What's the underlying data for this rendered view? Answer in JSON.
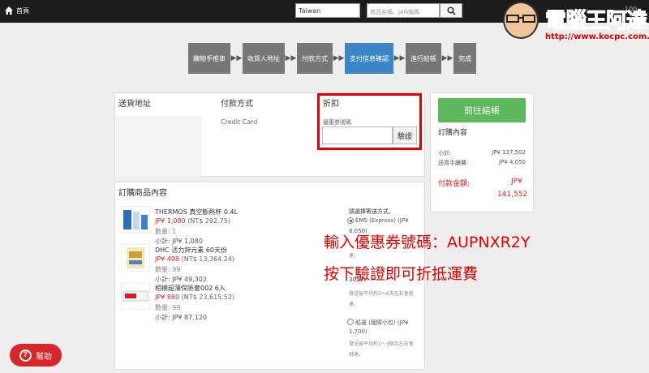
{
  "header": {
    "home_label": "首頁",
    "country_value": "Taiwan",
    "search_placeholder": "商品名稱、JAN編碼",
    "cart_count": "100"
  },
  "watermark": {
    "title": "電腦王阿達",
    "url": "http://www.kocpc.com.tw"
  },
  "steps": [
    {
      "label": "購物手推車"
    },
    {
      "label": "收貨人地址"
    },
    {
      "label": "付款方式"
    },
    {
      "label": "支付信息確認"
    },
    {
      "label": "進行結帳"
    },
    {
      "label": "完成"
    }
  ],
  "address": {
    "title": "送貨地址"
  },
  "payment": {
    "title": "付款方式",
    "value": "Credit Card"
  },
  "discount": {
    "title": "折扣",
    "coupon_label": "優惠券號碼",
    "verify_label": "驗證"
  },
  "order": {
    "title": "訂購商品內容",
    "items": [
      {
        "name": "THERMOS 真空斷熱杯 0.4L",
        "price_jp": "JP¥ 1,080",
        "price_nt": "(NT$ 292.75)",
        "qty": "數量: 1",
        "subtotal": "小計: JP¥ 1,080"
      },
      {
        "name": "DHC 活力鋅元素 60天份",
        "price_jp": "JP¥ 498",
        "price_nt": "(NT$ 13,364.24)",
        "qty": "數量: 99",
        "subtotal": "小計: JP¥ 49,302"
      },
      {
        "name": "相模超薄保險套002 6入",
        "price_jp": "JP¥ 880",
        "price_nt": "(NT$ 23,615.52)",
        "qty": "數量: 99",
        "subtotal": "小計: JP¥ 87,120"
      }
    ]
  },
  "shipping": {
    "title": "請選擇寄送方式。",
    "opt1_label": "EMS (Express) (JP¥",
    "opt1_price": "6,050)",
    "opt1_note": "達。",
    "opt2_price": "3025)",
    "opt2_note1": "發送後平均約3～6天左右會抵",
    "opt2_note2": "達。",
    "opt3_label": "船運 (國際小包) (JP¥",
    "opt3_price": "1,700)",
    "opt3_note1": "發送後平均約1～3個月左右會",
    "opt3_note2": "抵達。"
  },
  "summary": {
    "checkout_label": "前往結帳",
    "title": "訂購內容",
    "subtotal_label": "小計:",
    "subtotal_value": "JP¥ 137,502",
    "shipping_label": "送貨手續費:",
    "shipping_value": "JP¥ 4,050",
    "total_label": "付款金額:",
    "total_currency": "JP¥",
    "total_value": "141,552"
  },
  "annotation": {
    "line1": "輸入優惠券號碼：AUPNXR2Y",
    "line2": "按下驗證即可折抵運費"
  },
  "help": {
    "label": "幫助"
  },
  "colors": {
    "accent": "#3a86c8",
    "checkout": "#5cb85c",
    "price_red": "#e02020",
    "annotation": "#e60000"
  }
}
